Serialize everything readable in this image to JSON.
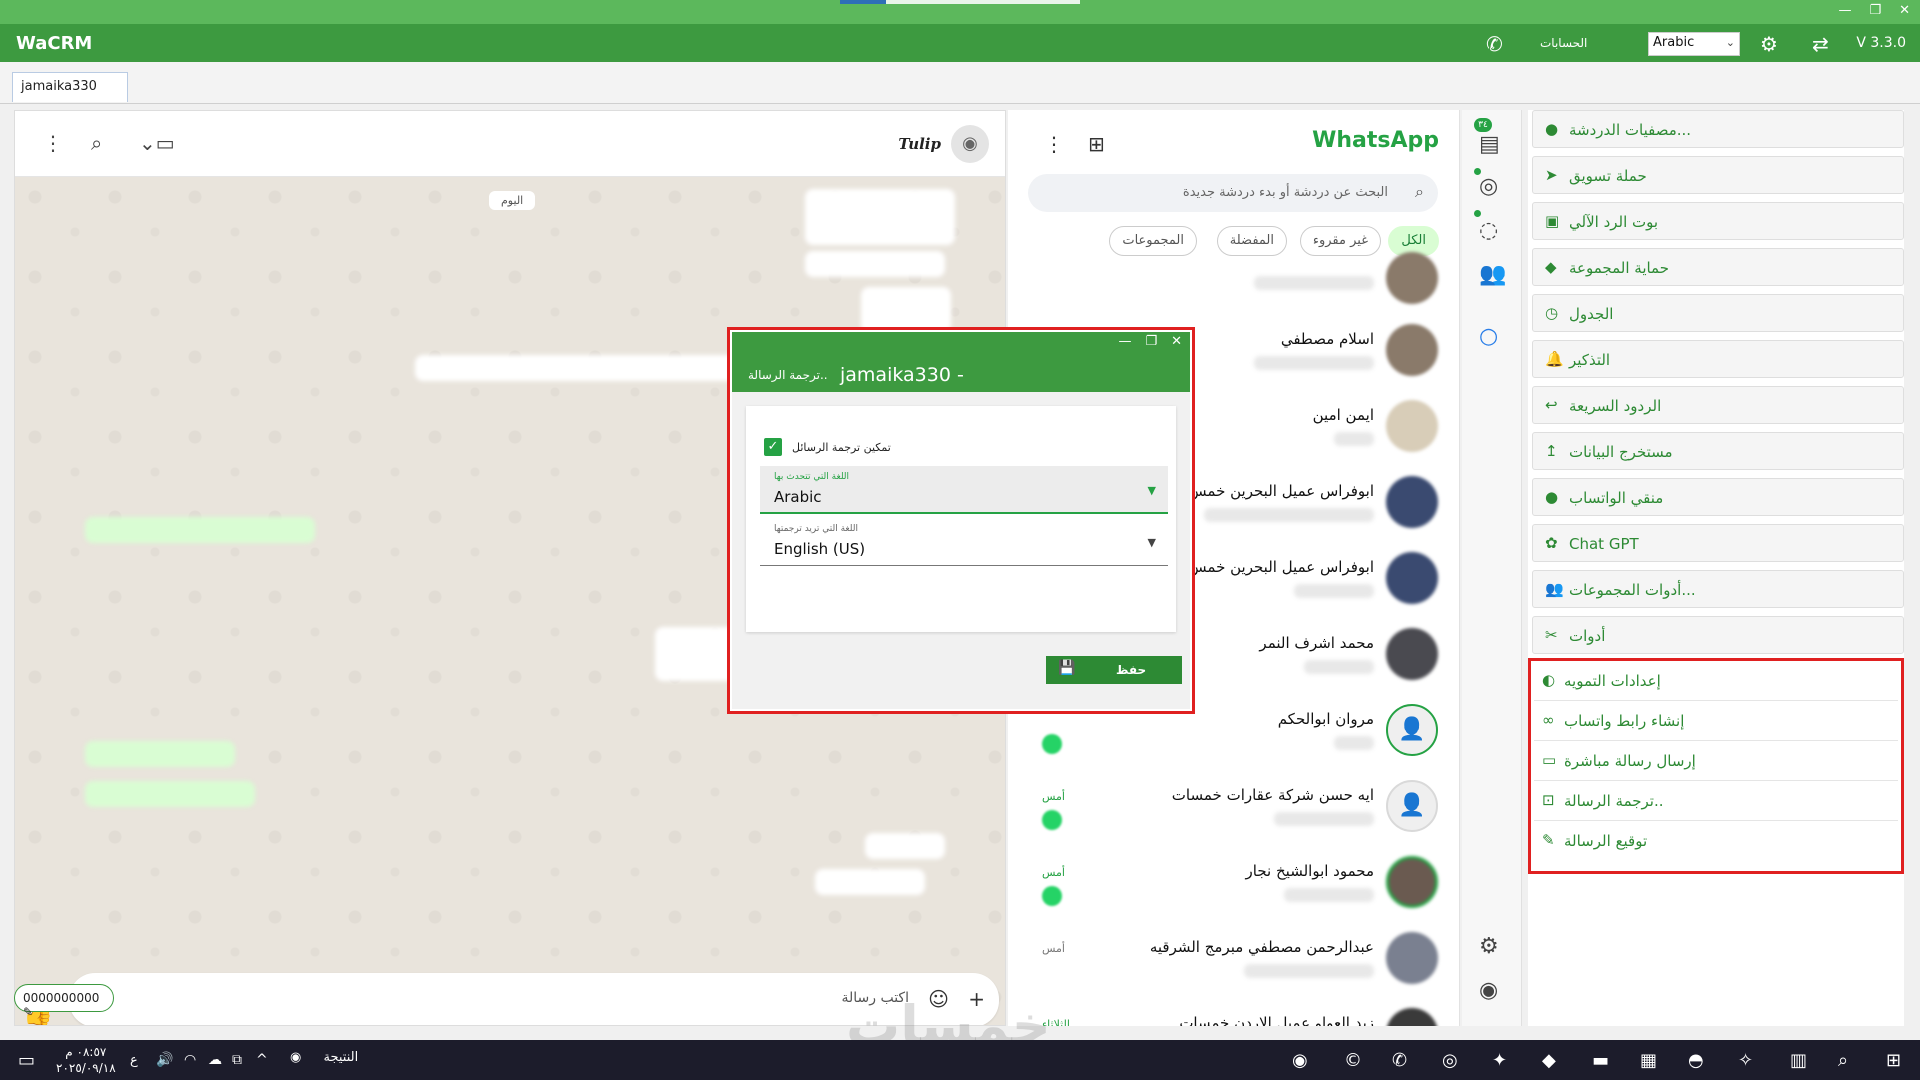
{
  "app": {
    "title": "WaCRM",
    "version": "V 3.3.0",
    "accounts_label": "الحسابات",
    "language": "Arabic"
  },
  "window_controls": [
    "—",
    "❐",
    "✕"
  ],
  "tabs": [
    {
      "label": "jamaika330"
    }
  ],
  "chat": {
    "contact_name": "Tulip",
    "day_badge": "اليوم",
    "composer_placeholder": "اكتب رسالة",
    "phone_chip": "0000000000"
  },
  "chatlist": {
    "brand": "WhatsApp",
    "search_placeholder": "البحث عن دردشة أو بدء دردشة جديدة",
    "filters": [
      "الكل",
      "غير مقروء",
      "المفضلة",
      "المجموعات"
    ],
    "items": [
      {
        "name": "اسلام مصطفي",
        "time": ""
      },
      {
        "name": "ايمن امين",
        "time": ""
      },
      {
        "name": "ابوفراس عميل البحرين خمس",
        "time": ""
      },
      {
        "name": "ابوفراس عميل البحرين خمس",
        "time": ""
      },
      {
        "name": "محمد اشرف النمر",
        "time": ""
      },
      {
        "name": "مروان ابوالحكم",
        "time": ""
      },
      {
        "name": "ايه حسن شركة عقارات خمسات",
        "time": "أمس"
      },
      {
        "name": "محمود ابوالشيخ نجار",
        "time": "أمس"
      },
      {
        "name": "عبدالرحمن مصطفي مبرمج الشرقيه",
        "time": "أمس"
      },
      {
        "name": "زيد العواو عميل الاردن خمسات",
        "time": "الثلاثاء"
      }
    ]
  },
  "rail": {
    "badge": "٣٤"
  },
  "menu": {
    "items": [
      {
        "label": "مصفيات الدردشة...",
        "icon": "filter-icon"
      },
      {
        "label": "حملة تسويق",
        "icon": "send-icon"
      },
      {
        "label": "بوت الرد الآلي",
        "icon": "robot-icon"
      },
      {
        "label": "حماية المجموعة",
        "icon": "shield-icon"
      },
      {
        "label": "الجدول",
        "icon": "clock-icon"
      },
      {
        "label": "التذكير",
        "icon": "bell-icon"
      },
      {
        "label": "الردود السريعة",
        "icon": "reply-icon"
      },
      {
        "label": "مستخرج البيانات",
        "icon": "extract-icon"
      },
      {
        "label": "منقي الواتساب",
        "icon": "filter-icon"
      },
      {
        "label": "Chat GPT",
        "icon": "openai-icon"
      },
      {
        "label": "أدوات المجموعات...",
        "icon": "group-icon"
      },
      {
        "label": "أدوات",
        "icon": "tools-icon"
      }
    ],
    "sub_items": [
      {
        "label": "إعدادات التمويه",
        "icon": "mask-icon"
      },
      {
        "label": "إنشاء رابط واتساب",
        "icon": "link-icon"
      },
      {
        "label": "إرسال رسالة مباشرة",
        "icon": "message-icon"
      },
      {
        "label": "ترجمة الرسالة..",
        "icon": "translate-icon"
      },
      {
        "label": "توقيع الرسالة",
        "icon": "pen-icon"
      }
    ]
  },
  "dialog": {
    "title": "jamaika330 -",
    "subtitle": "ترجمة الرسالة..",
    "enable_label": "تمكين ترجمة الرسائل",
    "enabled": true,
    "speak_language_label": "اللغة التي تتحدث بها",
    "speak_language_value": "Arabic",
    "target_language_label": "اللغة التي تريد ترجمتها",
    "target_language_value": "English (US)",
    "save_label": "حفظ"
  },
  "taskbar": {
    "time": "٠٨:٥٧ م",
    "date": "٢٠٢٥/٠٩/١٨",
    "input_lang": "ع",
    "weather": "النتيجة"
  },
  "watermark": "خمسات"
}
